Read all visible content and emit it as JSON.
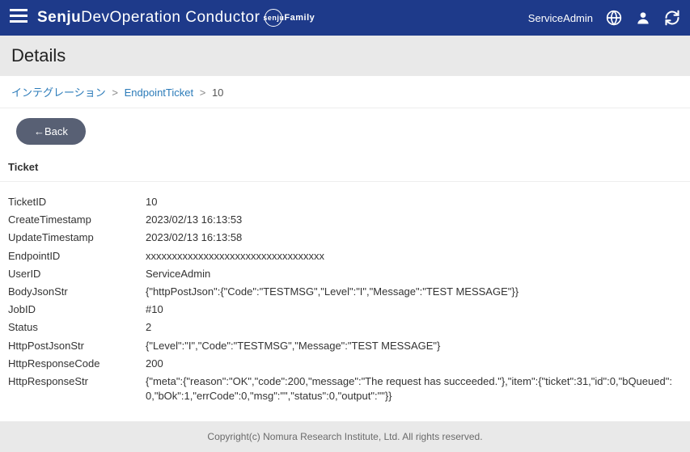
{
  "header": {
    "brand_bold": "Senju",
    "brand_light": " DevOperation Conductor",
    "brand_sub_circ": "senju",
    "brand_sub_text": "Family",
    "user": "ServiceAdmin"
  },
  "page": {
    "title": "Details"
  },
  "breadcrumbs": {
    "a": "インテグレーション",
    "b": "EndpointTicket",
    "current": "10"
  },
  "buttons": {
    "back": "Back"
  },
  "section_title": "Ticket",
  "fields": [
    {
      "label": "TicketID",
      "value": "10"
    },
    {
      "label": "CreateTimestamp",
      "value": "2023/02/13 16:13:53"
    },
    {
      "label": "UpdateTimestamp",
      "value": "2023/02/13 16:13:58"
    },
    {
      "label": "EndpointID",
      "value": "xxxxxxxxxxxxxxxxxxxxxxxxxxxxxxxxxx"
    },
    {
      "label": "UserID",
      "value": "ServiceAdmin"
    },
    {
      "label": "BodyJsonStr",
      "value": "{\"httpPostJson\":{\"Code\":\"TESTMSG\",\"Level\":\"I\",\"Message\":\"TEST MESSAGE\"}}"
    },
    {
      "label": "JobID",
      "value": "#10"
    },
    {
      "label": "Status",
      "value": "2"
    },
    {
      "label": "HttpPostJsonStr",
      "value": "{\"Level\":\"I\",\"Code\":\"TESTMSG\",\"Message\":\"TEST MESSAGE\"}"
    },
    {
      "label": "HttpResponseCode",
      "value": "200"
    },
    {
      "label": "HttpResponseStr",
      "value": "{\"meta\":{\"reason\":\"OK\",\"code\":200,\"message\":\"The request has succeeded.\"},\"item\":{\"ticket\":31,\"id\":0,\"bQueued\":0,\"bOk\":1,\"errCode\":0,\"msg\":\"\",\"status\":0,\"output\":\"\"}}"
    }
  ],
  "footer": "Copyright(c) Nomura Research Institute, Ltd. All rights reserved."
}
